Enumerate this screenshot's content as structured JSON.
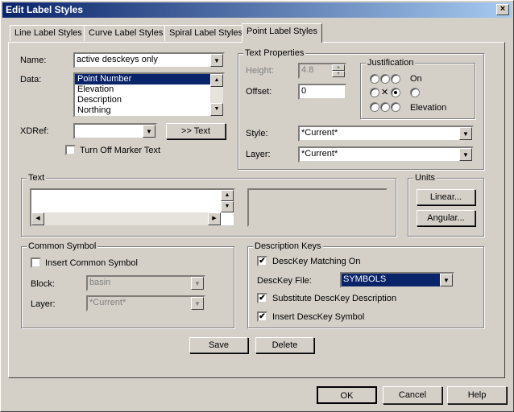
{
  "window": {
    "title": "Edit Label Styles",
    "close_glyph": "×"
  },
  "tabs": [
    "Line Label Styles",
    "Curve Label Styles",
    "Spiral Label Styles",
    "Point Label Styles"
  ],
  "left": {
    "name_label": "Name:",
    "name_value": "active desckeys only",
    "data_label": "Data:",
    "data_items": [
      "Point Number",
      "Elevation",
      "Description",
      "Northing"
    ],
    "xdref_label": "XDRef:",
    "xdref_value": "",
    "text_button": ">> Text",
    "turn_off_label": "Turn Off Marker Text"
  },
  "text_props": {
    "title": "Text Properties",
    "height_label": "Height:",
    "height_value": "4.8",
    "offset_label": "Offset:",
    "offset_value": "0",
    "justification_title": "Justification",
    "on_label": "On",
    "elevation_label": "Elevation",
    "x_glyph": "✕",
    "style_label": "Style:",
    "style_value": "*Current*",
    "layer_label": "Layer:",
    "layer_value": "*Current*"
  },
  "text_group": {
    "title": "Text"
  },
  "units": {
    "title": "Units",
    "linear_button": "Linear...",
    "angular_button": "Angular..."
  },
  "common_symbol": {
    "title": "Common Symbol",
    "insert_label": "Insert Common Symbol",
    "block_label": "Block:",
    "block_value": "basin",
    "layer_label": "Layer:",
    "layer_value": "*Current*"
  },
  "desc_keys": {
    "title": "Description Keys",
    "matching_label": "DescKey Matching On",
    "file_label": "DescKey File:",
    "file_value": "SYMBOLS",
    "substitute_label": "Substitute DescKey Description",
    "insert_label": "Insert DescKey Symbol",
    "check_glyph": "✔"
  },
  "actions": {
    "save": "Save",
    "delete": "Delete"
  },
  "footer": {
    "ok": "OK",
    "cancel": "Cancel",
    "help": "Help"
  },
  "arrows": {
    "down": "▼",
    "up": "▲",
    "left": "◀",
    "right": "▶"
  }
}
